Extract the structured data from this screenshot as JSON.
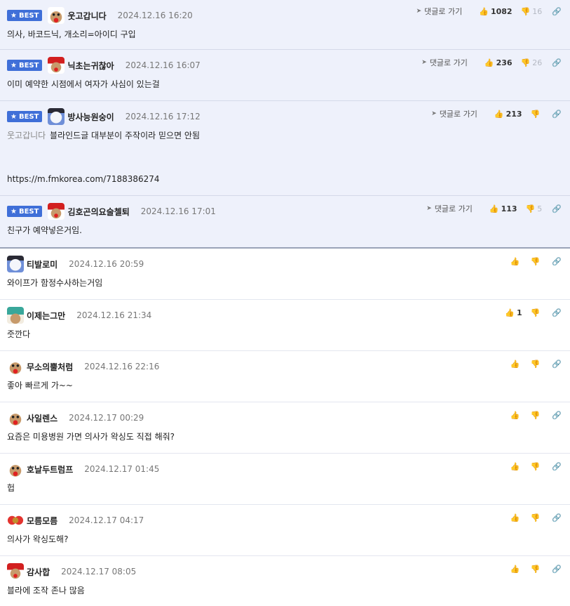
{
  "ui": {
    "best_label": "BEST",
    "reply_label": "댓글로 가기",
    "star_icon": "star-icon",
    "thumbs_up_icon": "thumbs-up-icon",
    "thumbs_down_icon": "thumbs-down-icon",
    "link_icon": "link-icon",
    "colors": {
      "best_badge": "#3f6fd8",
      "best_bg": "#eef1fb",
      "divider": "#e3e6ef"
    }
  },
  "best_comments": [
    {
      "nick": "웃고갑니다",
      "avatar": "reindeer",
      "date": "2024.12.16 16:20",
      "text": "의사, 바코드닉, 개소리=아이디 구입",
      "up": "1082",
      "down": "16"
    },
    {
      "nick": "닉초는귀찮아",
      "avatar": "santa",
      "date": "2024.12.16 16:07",
      "text": "이미 예약한 시점에서 여자가 사심이 있는걸",
      "up": "236",
      "down": "26"
    },
    {
      "nick": "방사능원숭이",
      "avatar": "snowman",
      "date": "2024.12.16 17:12",
      "ref": "웃고갑니다",
      "text": "블라인드글 대부분이 주작이라 믿으면 안됨",
      "link": "https://m.fmkorea.com/7188386274",
      "up": "213",
      "down": ""
    },
    {
      "nick": "김호곤의요술첼퇴",
      "avatar": "santa",
      "date": "2024.12.16 17:01",
      "text": "친구가 예약넣은거임.",
      "up": "113",
      "down": "5"
    }
  ],
  "comments": [
    {
      "nick": "티발로미",
      "avatar": "snowman",
      "date": "2024.12.16 20:59",
      "text": "와이프가 함정수사하는거임",
      "up": ""
    },
    {
      "nick": "이제는그만",
      "avatar": "hat",
      "date": "2024.12.16 21:34",
      "text": "줏깐다",
      "up": "1"
    },
    {
      "nick": "무소의뿔처럼",
      "avatar": "reindeer",
      "date": "2024.12.16 22:16",
      "text": "좋아 빠르게 가~~",
      "up": ""
    },
    {
      "nick": "사일렌스",
      "avatar": "reindeer",
      "date": "2024.12.17 00:29",
      "text": "요즘은 미용병원 가면 의사가 왁싱도 직접 해줘?",
      "up": ""
    },
    {
      "nick": "호날두트럼프",
      "avatar": "reindeer",
      "date": "2024.12.17 01:45",
      "text": "헙",
      "up": ""
    },
    {
      "nick": "모름모름",
      "avatar": "bow",
      "date": "2024.12.17 04:17",
      "text": "의사가 왁싱도해?",
      "up": ""
    },
    {
      "nick": "감사합",
      "avatar": "santa",
      "date": "2024.12.17 08:05",
      "text": "블라에 조작 존나 많음",
      "up": ""
    }
  ]
}
